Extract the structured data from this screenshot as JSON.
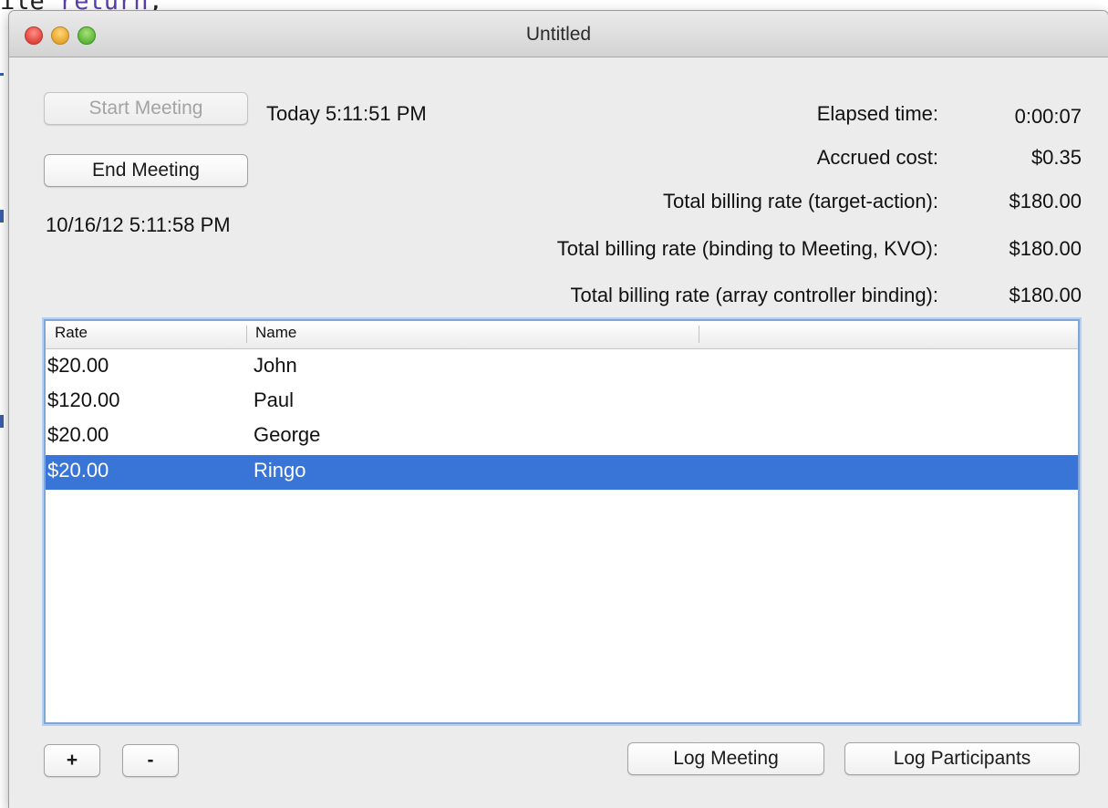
{
  "window": {
    "title": "Untitled"
  },
  "meeting": {
    "start_button": "Start Meeting",
    "end_button": "End Meeting",
    "start_time": "Today 5:11:51 PM",
    "end_time": "10/16/12 5:11:58 PM"
  },
  "stats": [
    {
      "label": "Elapsed time:",
      "value": "0:00:07"
    },
    {
      "label": "Accrued cost:",
      "value": "$0.35"
    },
    {
      "label": "Total billing rate (target-action):",
      "value": "$180.00"
    },
    {
      "label": "Total billing rate (binding to Meeting, KVO):",
      "value": "$180.00"
    },
    {
      "label": "Total billing rate (array controller binding):",
      "value": "$180.00"
    }
  ],
  "participants": {
    "columns": [
      "Rate",
      "Name"
    ],
    "rows": [
      {
        "rate": "$20.00",
        "name": "John",
        "selected": false
      },
      {
        "rate": "$120.00",
        "name": "Paul",
        "selected": false
      },
      {
        "rate": "$20.00",
        "name": "George",
        "selected": false
      },
      {
        "rate": "$20.00",
        "name": "Ringo",
        "selected": true
      }
    ]
  },
  "actions": {
    "add_button": "+",
    "remove_button": "-",
    "log_meeting_button": "Log Meeting",
    "log_participants_button": "Log Participants"
  },
  "colors": {
    "selection": "#3875d7",
    "table_focus_ring": "#7ea7d8"
  }
}
